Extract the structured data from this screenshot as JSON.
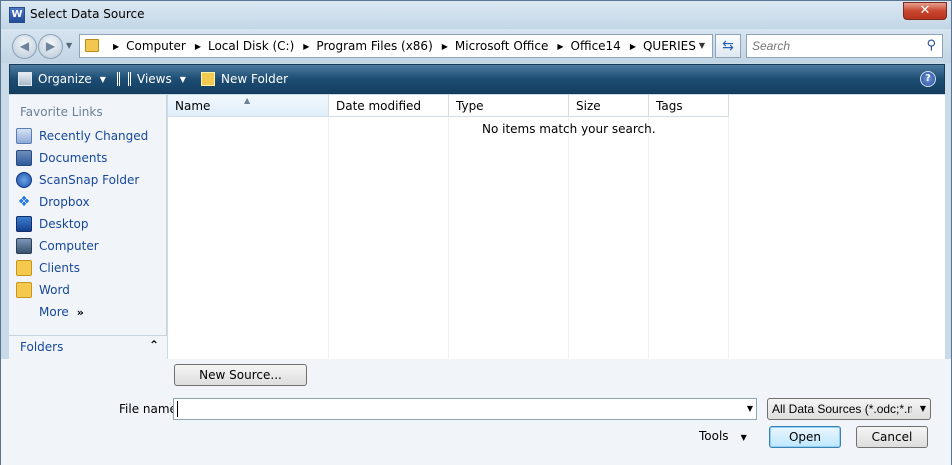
{
  "window": {
    "title": "Select Data Source",
    "app_icon": "W"
  },
  "address": {
    "crumbs": [
      "Computer",
      "Local Disk (C:)",
      "Program Files (x86)",
      "Microsoft Office",
      "Office14",
      "QUERIES"
    ],
    "search_placeholder": "Search"
  },
  "toolbar": {
    "organize": "Organize",
    "views": "Views",
    "new_folder": "New Folder",
    "help": "?"
  },
  "nav": {
    "favorites_title": "Favorite Links",
    "items": [
      {
        "label": "Recently Changed",
        "icon": "recent-icon"
      },
      {
        "label": "Documents",
        "icon": "documents-icon"
      },
      {
        "label": "ScanSnap Folder",
        "icon": "scansnap-icon"
      },
      {
        "label": "Dropbox",
        "icon": "dropbox-icon"
      },
      {
        "label": "Desktop",
        "icon": "desktop-icon"
      },
      {
        "label": "Computer",
        "icon": "computer-icon"
      },
      {
        "label": "Clients",
        "icon": "folder-icon"
      },
      {
        "label": "Word",
        "icon": "folder-icon"
      }
    ],
    "more": "More",
    "folders": "Folders"
  },
  "filelist": {
    "columns": [
      "Name",
      "Date modified",
      "Type",
      "Size",
      "Tags"
    ],
    "empty_message": "No items match your search."
  },
  "bottom": {
    "new_source": "New Source...",
    "file_name_label": "File name:",
    "file_name_value": "",
    "file_type": "All Data Sources (*.odc;*.mdb",
    "tools": "Tools",
    "open": "Open",
    "cancel": "Cancel"
  }
}
